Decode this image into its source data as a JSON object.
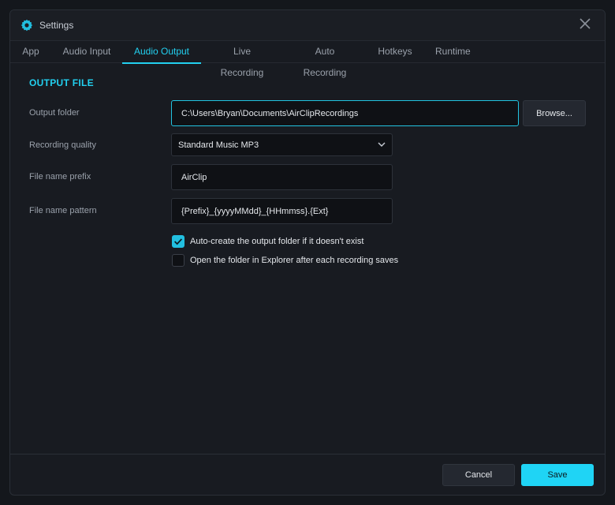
{
  "window": {
    "title": "Settings"
  },
  "tabs": [
    {
      "label": "App",
      "active": false
    },
    {
      "label": "Audio Input",
      "active": false
    },
    {
      "label": "Audio Output",
      "active": true
    },
    {
      "label": "Live Recording",
      "active": false
    },
    {
      "label": "Auto Recording",
      "active": false
    },
    {
      "label": "Hotkeys",
      "active": false
    },
    {
      "label": "Runtime",
      "active": false
    }
  ],
  "section": {
    "title": "OUTPUT FILE"
  },
  "form": {
    "output_folder": {
      "label": "Output folder",
      "value": "C:\\Users\\Bryan\\Documents\\AirClipRecordings",
      "browse_label": "Browse..."
    },
    "quality": {
      "label": "Recording quality",
      "selected": "Standard Music MP3"
    },
    "prefix": {
      "label": "File name prefix",
      "value": "AirClip"
    },
    "pattern": {
      "label": "File name pattern",
      "value": "{Prefix}_{yyyyMMdd}_{HHmmss}.{Ext}"
    },
    "auto_create": {
      "label": "Auto-create the output folder if it doesn't exist",
      "checked": true
    },
    "open_explorer": {
      "label": "Open the folder in Explorer after each recording saves",
      "checked": false
    }
  },
  "footer": {
    "cancel_label": "Cancel",
    "save_label": "Save"
  },
  "colors": {
    "accent": "#22d0f0",
    "background": "#181b21",
    "field_bg": "#0f1115"
  },
  "icons": {
    "app": "gear-icon",
    "close": "close-icon",
    "select": "chevron-down-icon",
    "check": "checkmark-icon"
  }
}
